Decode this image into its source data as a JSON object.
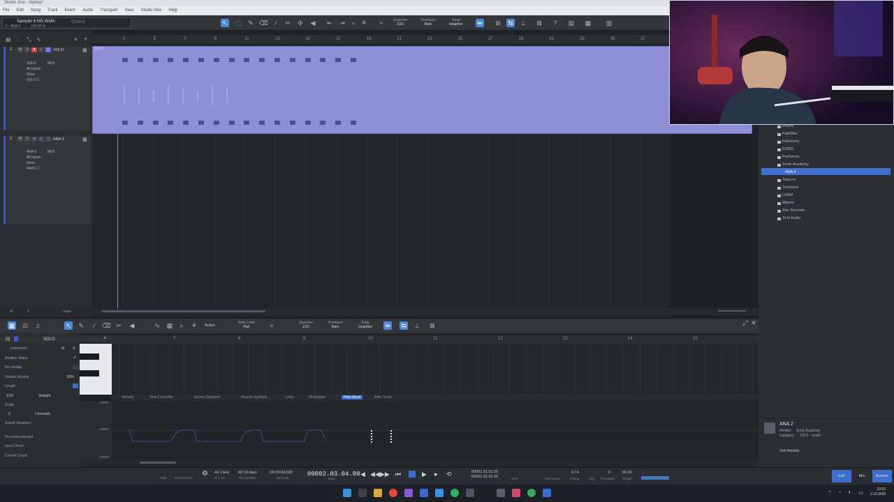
{
  "window": {
    "title": "Studio One - triphop*"
  },
  "menu": [
    "File",
    "Edit",
    "Song",
    "Track",
    "Event",
    "Audio",
    "Transport",
    "View",
    "Studio One",
    "Help"
  ],
  "instrument_selector": {
    "name": "Sampler 6 MS Width",
    "sub": "2 - ANA 2",
    "sub2": "100.00 %",
    "control": "Control"
  },
  "toolbar": {
    "quantize": {
      "label": "Quantize",
      "value": "1/16"
    },
    "timebase": {
      "label": "Timebase",
      "value": "Bars"
    },
    "snap": {
      "label": "Snap",
      "value": "Adaptive"
    }
  },
  "ruler": [
    "3",
    "5",
    "7",
    "9",
    "11",
    "13",
    "15",
    "17",
    "19",
    "21",
    "23",
    "25",
    "27",
    "29",
    "31",
    "33",
    "35",
    "37"
  ],
  "tracks": [
    {
      "num": "1",
      "name": "SOLO",
      "input": "All Inputs",
      "midi": "MIDI",
      "out": "None",
      "chan": "SOLO 1",
      "label": "SOLO"
    },
    {
      "num": "2",
      "name": "ANA 2",
      "input": "All Inputs",
      "midi": "MIDI",
      "out": "None",
      "chan": "ANA 2.1",
      "label": "ANA 2 + 1"
    }
  ],
  "event": {
    "label": "SOLO"
  },
  "arrange_status": {
    "m": "M",
    "s": "S",
    "large": "Large"
  },
  "browser": {
    "items": [
      "Arturia",
      "FabFilter",
      "Kilohearts",
      "KORG",
      "PreSonus",
      "Sonic Academy",
      "ANA 2",
      "Taqs.im",
      "Toontrack",
      "UJAM",
      "Waves",
      "Xfer Records",
      "XLN Audio"
    ],
    "selected": "ANA 2"
  },
  "info": {
    "title": "ANA 2",
    "vendor_label": "Vendor:",
    "vendor": "Sonic Academy",
    "category_label": "Category:",
    "category": "VST3 · Synth",
    "link": "Visit Website"
  },
  "editor": {
    "track": "SOLO",
    "action": "Action",
    "note_color": {
      "label": "Note Color",
      "value": "Part"
    },
    "quantize": {
      "label": "Quantize",
      "value": "1/16"
    },
    "timebase": {
      "label": "Timebase",
      "value": "Bars"
    },
    "snap": {
      "label": "Snap",
      "value": "Quantize"
    },
    "ruler": [
      "7",
      "8",
      "9",
      "10",
      "11",
      "12",
      "13",
      "14",
      "15"
    ],
    "left_panel": {
      "instrument": "Instrument",
      "audition": "Audition Notes",
      "no_overlap": "No overlap",
      "default_velocity": "Default Velocity",
      "velocity_value": "80%",
      "length": "Length",
      "length_value": "1/16",
      "length_mode": "Straight",
      "scale": "Scale",
      "scale_key": "C",
      "scale_mode": "Chromatic",
      "sound_variations": "Sound Variations",
      "no_event": "No event selected",
      "input_chord": "Input Chord",
      "current_chord": "Current Chord"
    },
    "ctrl_tabs": [
      "Velocity",
      "Note Controller",
      "Sound Variations",
      "Musical Symbols",
      "Lyrics",
      "Modulation",
      "Pitch Bend",
      "After Touch"
    ],
    "ctrl_active": "Pitch Bend",
    "ctrl_scale": [
      "1.0000",
      "0.5000",
      "0.0000"
    ]
  },
  "transport": {
    "midi": "MIDI",
    "performance": "Performance",
    "sample_rate": "44.1 kHz",
    "latency": "0.0 ms",
    "record_max": "42:19 days",
    "record_max_label": "Record Max",
    "seconds": "00:00:04.500",
    "seconds_label": "Seconds",
    "bars_time": "00002.03.04.00",
    "bars_label": "Bars",
    "loop_l": "00001.01.01.00",
    "loop_r": "00001.01.01.00",
    "sync": "Sync",
    "metronome": "Metronome",
    "signature": "4 / 4",
    "timing": "Timing",
    "key": "Key",
    "transpose": "0",
    "transpose_label": "Transpose",
    "tempo": "90.00",
    "tempo_label": "Tempo",
    "edit": "Edit",
    "mix": "Mix",
    "browse": "Browse"
  },
  "clock": {
    "time": "22:02",
    "date": "2.10.2025"
  },
  "colors": {
    "accent": "#4e89d8",
    "event": "#8e8fd4",
    "track_stripe": "#3f56c9"
  }
}
